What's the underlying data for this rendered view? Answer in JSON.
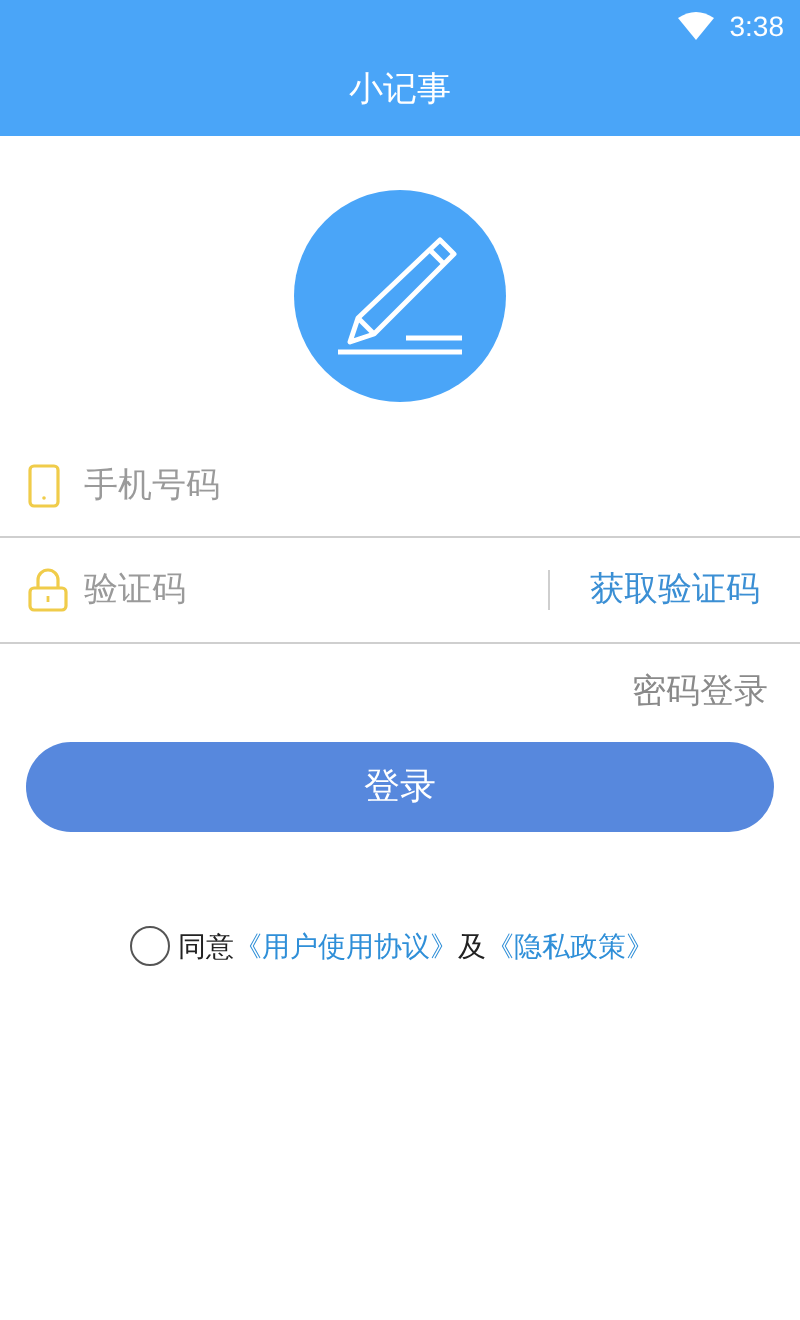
{
  "status_bar": {
    "time": "3:38"
  },
  "app_bar": {
    "title": "小记事"
  },
  "phone_field": {
    "placeholder": "手机号码"
  },
  "code_field": {
    "placeholder": "验证码",
    "action": "获取验证码"
  },
  "password_login": "密码登录",
  "login_button": "登录",
  "agreement": {
    "checked": false,
    "parts": [
      {
        "kind": "text",
        "text": "同意"
      },
      {
        "kind": "link",
        "text": "《用户使用协议》"
      },
      {
        "kind": "text",
        "text": "及"
      },
      {
        "kind": "link",
        "text": "《隐私政策》"
      }
    ]
  }
}
